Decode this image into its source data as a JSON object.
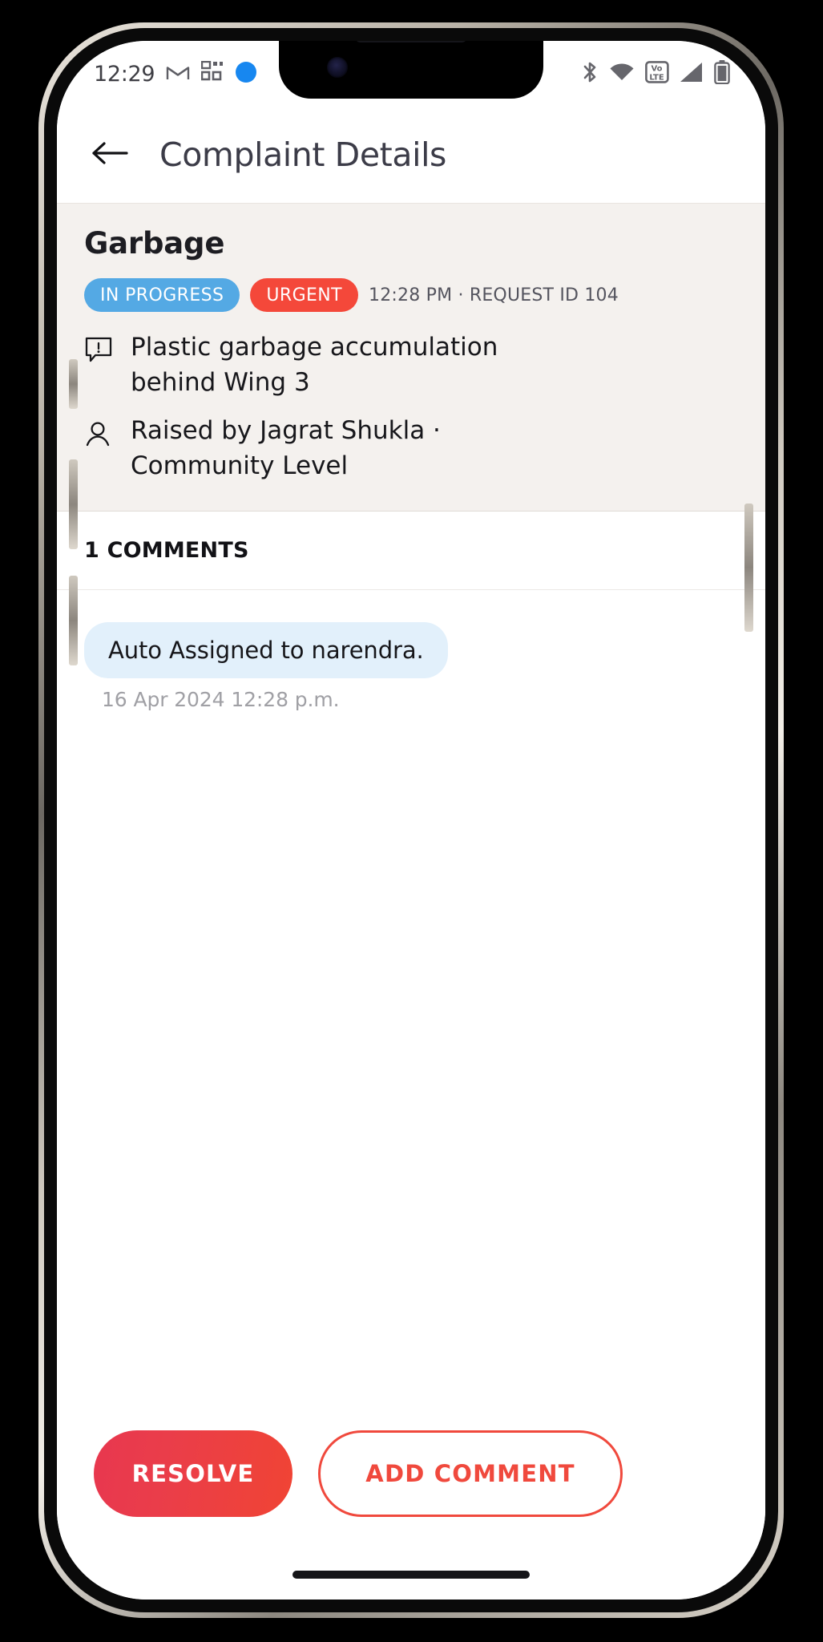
{
  "status_bar": {
    "time": "12:29",
    "left_icons": [
      "gmail-icon",
      "qr-scanner-icon",
      "blue-app-icon"
    ],
    "right_icons": [
      "bluetooth-icon",
      "wifi-icon",
      "volte-icon",
      "cellular-signal-icon",
      "battery-icon"
    ],
    "volte_label_top": "Vo",
    "volte_label_bottom": "LTE"
  },
  "appbar": {
    "back_icon": "arrow-left-icon",
    "title": "Complaint Details"
  },
  "card": {
    "title": "Garbage",
    "badges": [
      {
        "label": "IN PROGRESS",
        "color": "#54a9e4"
      },
      {
        "label": "URGENT",
        "color": "#f4483a"
      }
    ],
    "meta": "12:28 PM ·  REQUEST ID 104",
    "description": "Plastic garbage accumulation behind Wing 3",
    "description_icon": "comment-alert-icon",
    "raised_by": "Raised by Jagrat Shukla   · Community Level",
    "raised_by_icon": "person-icon"
  },
  "comments": {
    "header": "1 COMMENTS",
    "items": [
      {
        "text": "Auto Assigned to narendra.",
        "timestamp": "16 Apr 2024 12:28 p.m.",
        "bubble_color": "#e2f0fb"
      }
    ]
  },
  "actions": {
    "resolve_label": "RESOLVE",
    "add_comment_label": "ADD COMMENT",
    "accent_color": "#f0493d"
  }
}
